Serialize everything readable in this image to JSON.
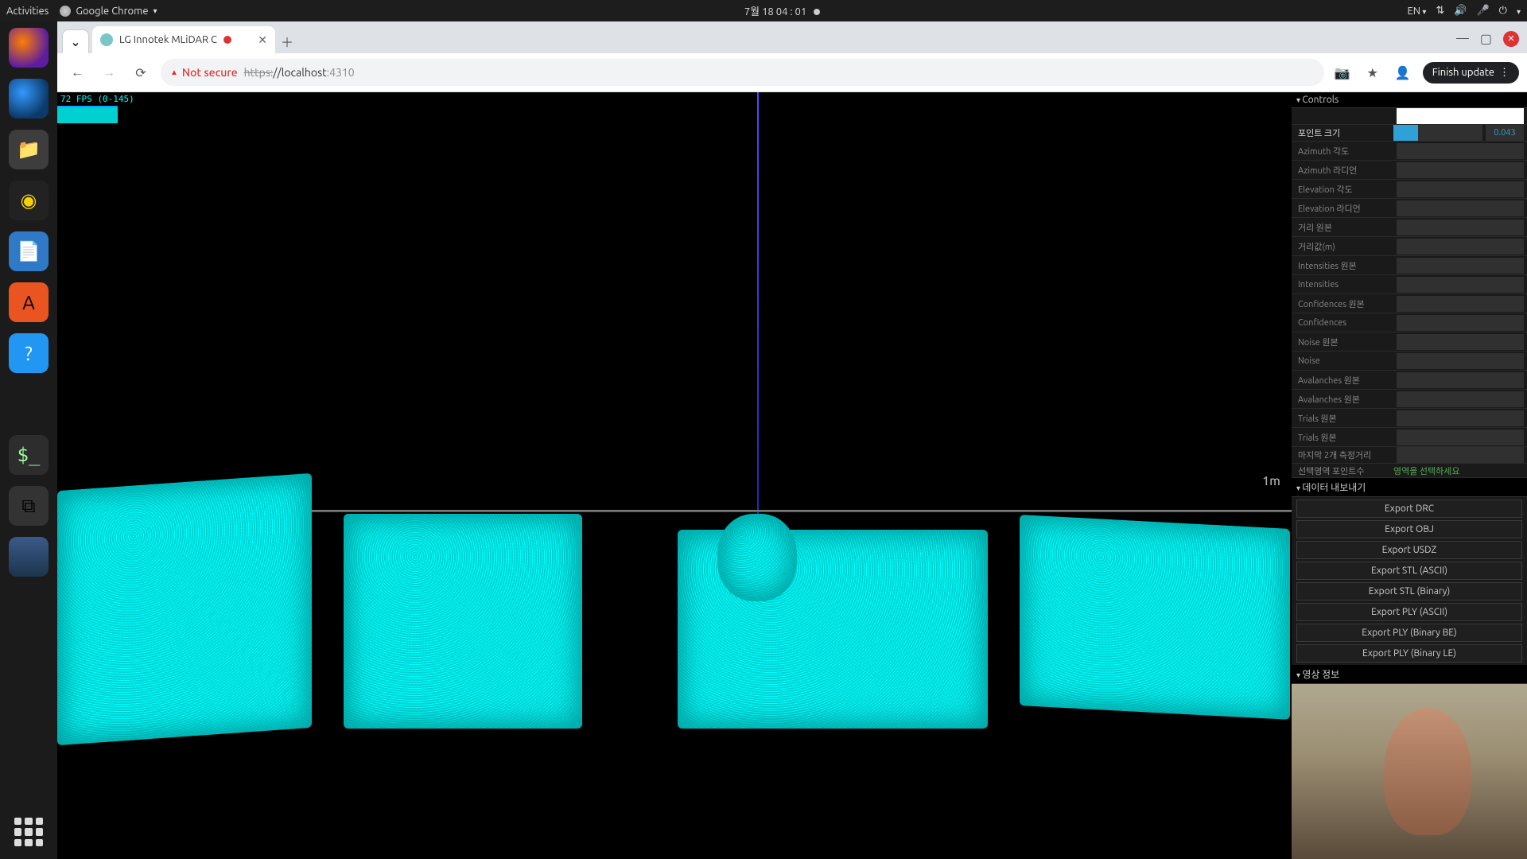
{
  "topbar": {
    "activities": "Activities",
    "app": "Google Chrome",
    "clock": "7월 18  04 : 01",
    "lang": "EN"
  },
  "tab": {
    "title": "LG Innotek MLiDAR C"
  },
  "omnibar": {
    "not_secure": "Not secure",
    "url_scheme": "https:",
    "url_host": "//localhost",
    "url_rest": ":4310",
    "finish_update": "Finish update"
  },
  "fps": {
    "line": "72 FPS (0-145)"
  },
  "scale": "1m",
  "panel": {
    "controls_header": "Controls",
    "export_header": "데이터 내보내기",
    "video_header": "영상 정보",
    "point_size": {
      "label": "포인트 크기",
      "value": "0.043",
      "pct": 28
    },
    "rows": [
      "Azimuth 각도",
      "Azimuth 라디언",
      "Elevation 각도",
      "Elevation 라디언",
      "거리 원본",
      "거리값(m)",
      "Intensities 원본",
      "Intensities",
      "Confidences 원본",
      "Confidences",
      "Noise 원본",
      "Noise",
      "Avalanches 원본",
      "Avalanches 원본",
      "Trials 원본",
      "Trials 원본"
    ],
    "last2_label": "마지막 2개 측정거리",
    "sel_label": "선택영역 포인트수",
    "sel_msg": "영역을 선택하세요",
    "exports": [
      "Export DRC",
      "Export OBJ",
      "Export USDZ",
      "Export STL (ASCII)",
      "Export STL (Binary)",
      "Export PLY (ASCII)",
      "Export PLY (Binary BE)",
      "Export PLY (Binary LE)"
    ]
  }
}
